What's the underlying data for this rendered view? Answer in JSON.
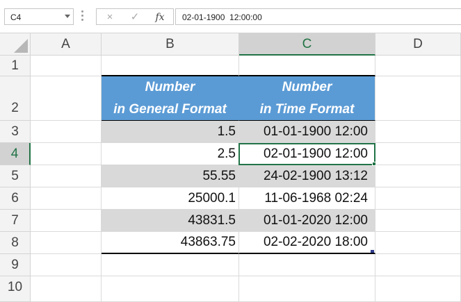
{
  "formula_bar": {
    "name_box": "C4",
    "cancel_icon": "×",
    "enter_icon": "✓",
    "fx_label": "fx",
    "formula": "02-01-1900  12:00:00"
  },
  "columns": [
    "A",
    "B",
    "C",
    "D"
  ],
  "rows": [
    "1",
    "2",
    "3",
    "4",
    "5",
    "6",
    "7",
    "8",
    "9",
    "10"
  ],
  "table": {
    "header_b_line1": "Number",
    "header_b_line2": "in General Format",
    "header_c_line1": "Number",
    "header_c_line2": "in  Time  Format",
    "data": [
      {
        "number": "1.5",
        "time": "01-01-1900 12:00"
      },
      {
        "number": "2.5",
        "time": "02-01-1900 12:00"
      },
      {
        "number": "55.55",
        "time": "24-02-1900 13:12"
      },
      {
        "number": "25000.1",
        "time": "11-06-1968 02:24"
      },
      {
        "number": "43831.5",
        "time": "01-01-2020 12:00"
      },
      {
        "number": "43863.75",
        "time": "02-02-2020 18:00"
      }
    ]
  },
  "selected_cell": "C4",
  "colors": {
    "header_fill": "#5b9bd5",
    "shade_fill": "#d9d9d9",
    "selection": "#217346"
  }
}
